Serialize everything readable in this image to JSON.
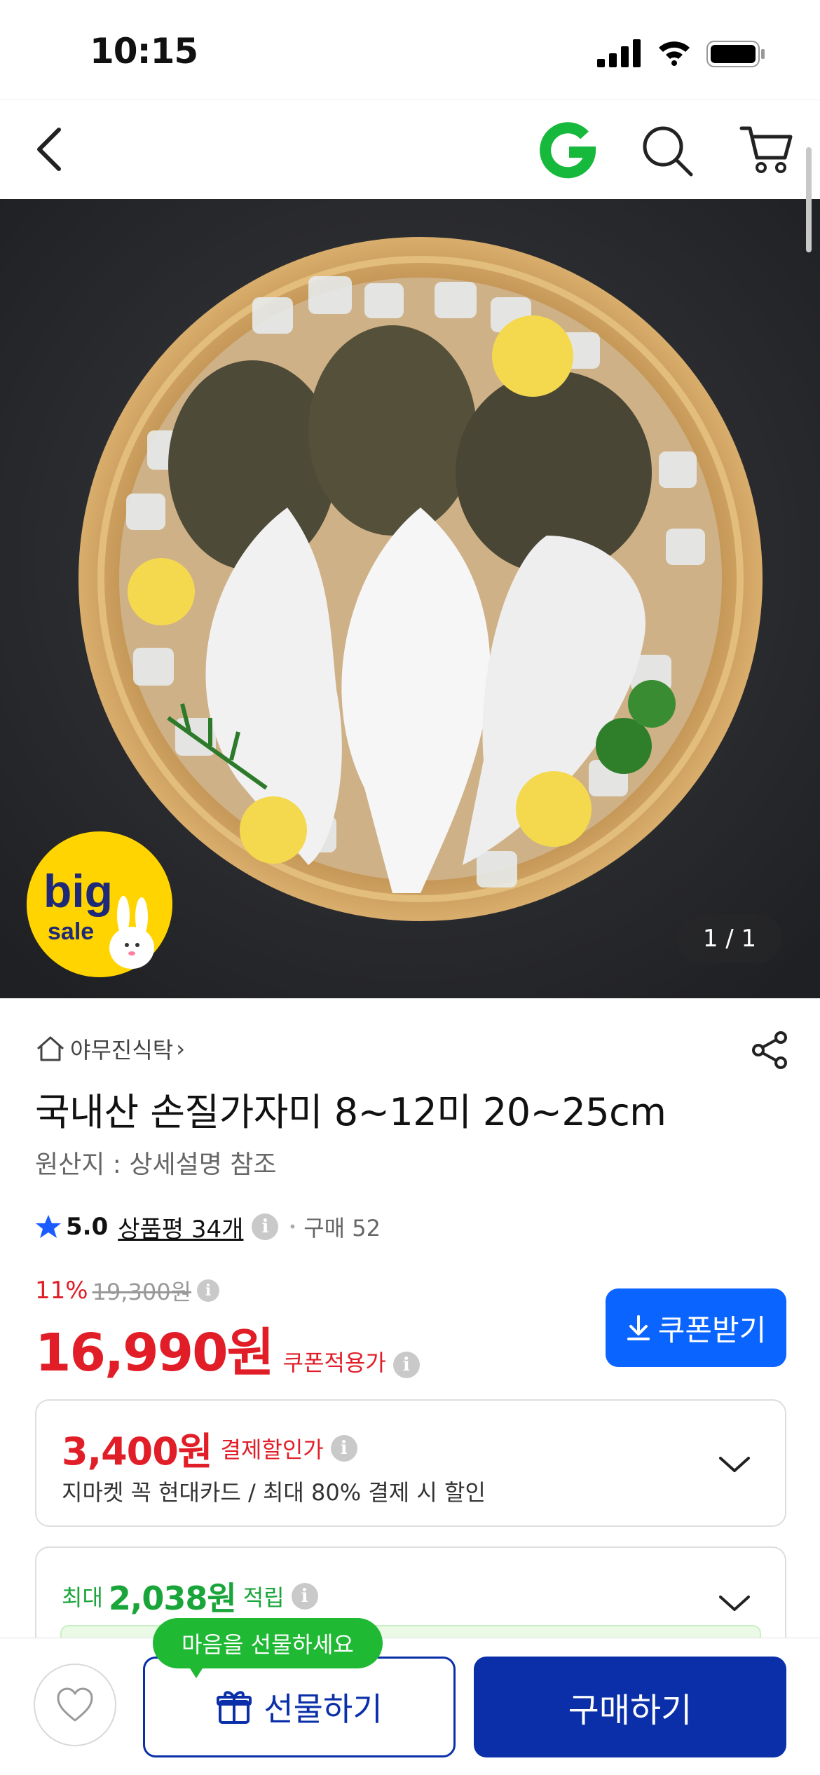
{
  "status_bar": {
    "time": "10:15"
  },
  "nav": {
    "back_icon": "chevron-left-icon",
    "logo": "gmarket-g-logo",
    "search_icon": "search-icon",
    "cart_icon": "cart-icon"
  },
  "product_image": {
    "badge_text_top": "big",
    "badge_text_bottom": "sale",
    "counter": "1 / 1"
  },
  "seller": {
    "name": "야무진식탁",
    "chevron": "›"
  },
  "product": {
    "title": "국내산 손질가자미 8~12미 20~25cm",
    "origin": "원산지 : 상세설명 참조",
    "rating": "5.0",
    "reviews": "상품평 34개",
    "purchases": "구매 52"
  },
  "pricing": {
    "discount_rate": "11%",
    "original_price": "19,300원",
    "price": "16,990원",
    "price_label": "쿠폰적용가",
    "coupon_button": "쿠폰받기"
  },
  "payment_card": {
    "price": "3,400원",
    "label": "결제할인가",
    "description": "지마켓 꼭 현대카드 / 최대 80% 결제 시 할인"
  },
  "point_card": {
    "prefix": "최대",
    "value": "2,038원",
    "suffix": "적립"
  },
  "bottom_bar": {
    "tooltip": "마음을 선물하세요",
    "gift_button": "선물하기",
    "buy_button": "구매하기"
  },
  "colors": {
    "discount_red": "#e11e27",
    "coupon_blue": "#0a64ff",
    "brand_navy": "#0a2fa8",
    "point_green": "#1aa53a"
  }
}
